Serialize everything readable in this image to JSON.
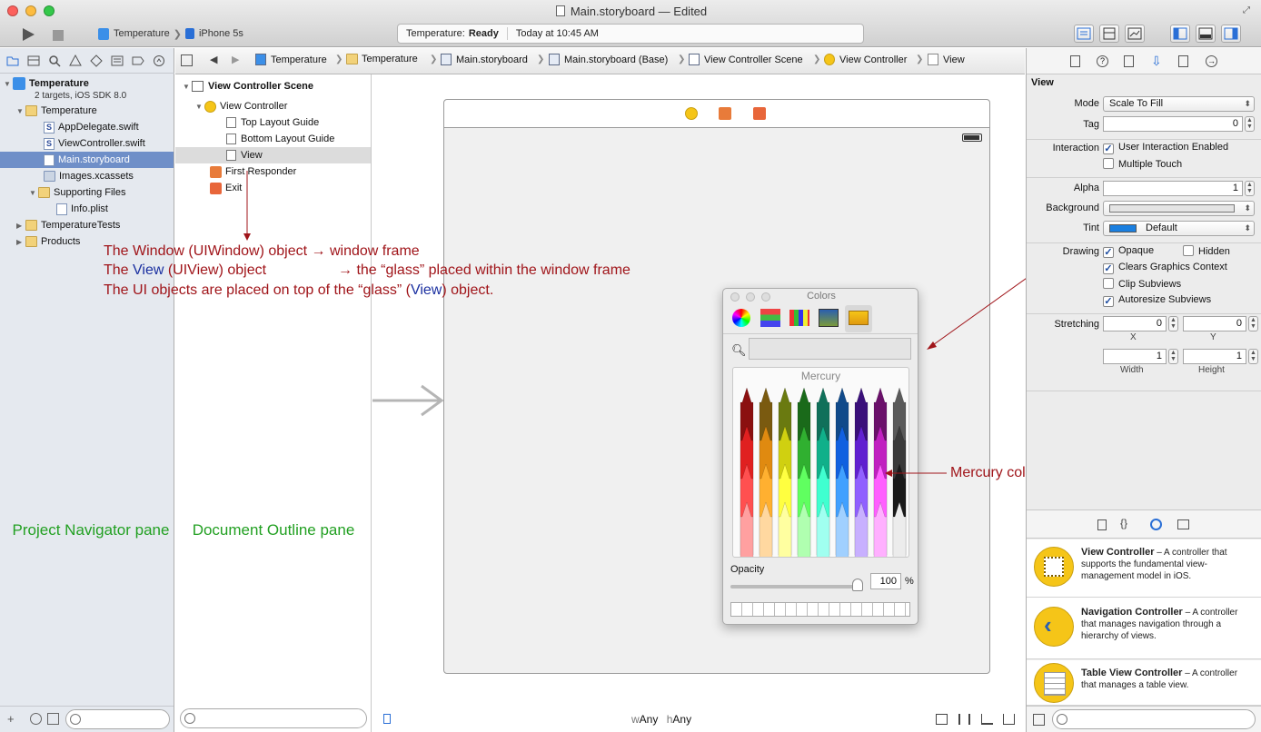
{
  "window": {
    "title": "Main.storyboard — Edited"
  },
  "toolbar": {
    "scheme": "Temperature",
    "device": "iPhone 5s",
    "activity_prefix": "Temperature:",
    "activity_status": "Ready",
    "activity_time": "Today at 10:45 AM"
  },
  "jumpbar": {
    "crumbs": [
      "Temperature",
      "Temperature",
      "Main.storyboard",
      "Main.storyboard (Base)",
      "View Controller Scene",
      "View Controller",
      "View"
    ]
  },
  "navigator": {
    "project_name": "Temperature",
    "project_sub": "2 targets, iOS SDK 8.0",
    "items": [
      {
        "label": "Temperature"
      },
      {
        "label": "AppDelegate.swift"
      },
      {
        "label": "ViewController.swift"
      },
      {
        "label": "Main.storyboard"
      },
      {
        "label": "Images.xcassets"
      },
      {
        "label": "Supporting Files"
      },
      {
        "label": "Info.plist"
      },
      {
        "label": "TemperatureTests"
      },
      {
        "label": "Products"
      }
    ],
    "pane_label": "Project Navigator pane"
  },
  "outline": {
    "items": [
      {
        "label": "View Controller Scene"
      },
      {
        "label": "View Controller"
      },
      {
        "label": "Top Layout Guide"
      },
      {
        "label": "Bottom Layout Guide"
      },
      {
        "label": "View"
      },
      {
        "label": "First Responder"
      },
      {
        "label": "Exit"
      }
    ],
    "pane_label": "Document Outline pane"
  },
  "annotations": {
    "line1": "The Window (UIWindow) object → window frame",
    "line2_a": "The ",
    "line2_view": "View",
    "line2_b": " (UIView) object",
    "line2_c": "→ the “glass” placed within the window frame",
    "line3_a": "The UI objects are placed on top of the “glass” (",
    "line3_view": "View",
    "line3_b": ") object.",
    "mercury": "Mercury color"
  },
  "colors_panel": {
    "title": "Colors",
    "selected_color": "Mercury",
    "opacity_label": "Opacity",
    "opacity_value": "100",
    "percent": "%"
  },
  "canvas": {
    "size_w": "w",
    "size_w_val": "Any",
    "size_h": "h",
    "size_h_val": "Any"
  },
  "inspector": {
    "section": "View",
    "mode_label": "Mode",
    "mode_value": "Scale To Fill",
    "tag_label": "Tag",
    "tag_value": "0",
    "interaction_label": "Interaction",
    "user_interaction": "User Interaction Enabled",
    "multiple_touch": "Multiple Touch",
    "alpha_label": "Alpha",
    "alpha_value": "1",
    "background_label": "Background",
    "tint_label": "Tint",
    "tint_value": "Default",
    "drawing_label": "Drawing",
    "opaque": "Opaque",
    "hidden": "Hidden",
    "clears": "Clears Graphics Context",
    "clip": "Clip Subviews",
    "autoresize": "Autoresize Subviews",
    "stretching_label": "Stretching",
    "stretch_x": "0",
    "stretch_y": "0",
    "x_label": "X",
    "y_label": "Y",
    "width_value": "1",
    "height_value": "1",
    "width_label": "Width",
    "height_label": "Height"
  },
  "library": {
    "items": [
      {
        "title": "View Controller",
        "desc": " – A controller that supports the fundamental view-management model in iOS."
      },
      {
        "title": "Navigation Controller",
        "desc": " – A controller that manages navigation through a hierarchy of views."
      },
      {
        "title": "Table View Controller",
        "desc": " – A controller that manages a table view."
      }
    ]
  },
  "colors": {
    "annotation_red": "#a0151a",
    "label_green": "#22a022",
    "view_blue": "#1a2fa0",
    "selection": "#6f8fc8"
  }
}
